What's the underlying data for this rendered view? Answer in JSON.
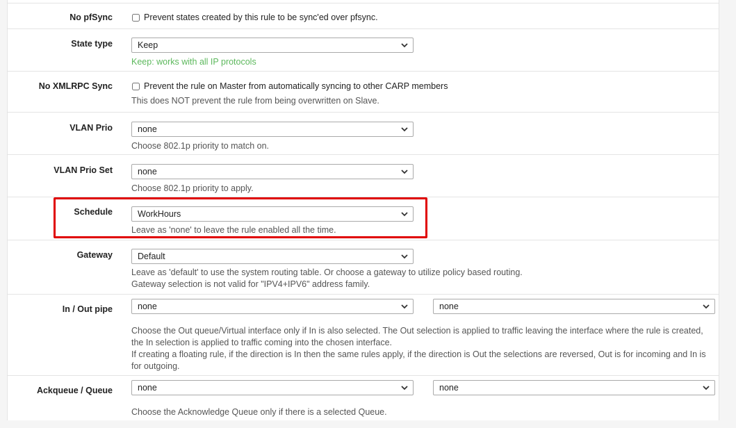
{
  "rows": {
    "pfsync": {
      "label": "No pfSync",
      "checkbox_label": "Prevent states created by this rule to be sync'ed over pfsync."
    },
    "state_type": {
      "label": "State type",
      "value": "Keep",
      "help": "Keep: works with all IP protocols"
    },
    "xmlrpc": {
      "label": "No XMLRPC Sync",
      "checkbox_label": "Prevent the rule on Master from automatically syncing to other CARP members",
      "help": "This does NOT prevent the rule from being overwritten on Slave."
    },
    "vlan_prio": {
      "label": "VLAN Prio",
      "value": "none",
      "help": "Choose 802.1p priority to match on."
    },
    "vlan_prio_set": {
      "label": "VLAN Prio Set",
      "value": "none",
      "help": "Choose 802.1p priority to apply."
    },
    "schedule": {
      "label": "Schedule",
      "value": "WorkHours",
      "help": "Leave as 'none' to leave the rule enabled all the time."
    },
    "gateway": {
      "label": "Gateway",
      "value": "Default",
      "help1": "Leave as 'default' to use the system routing table. Or choose a gateway to utilize policy based routing.",
      "help2": "Gateway selection is not valid for \"IPV4+IPV6\" address family."
    },
    "pipe": {
      "label": "In / Out pipe",
      "in_value": "none",
      "out_value": "none",
      "help1": "Choose the Out queue/Virtual interface only if In is also selected. The Out selection is applied to traffic leaving the interface where the rule is created,",
      "help2": "the In selection is applied to traffic coming into the chosen interface.",
      "help3": "If creating a floating rule, if the direction is In then the same rules apply, if the direction is Out the selections are reversed, Out is for incoming and In is",
      "help4": "for outgoing."
    },
    "queue": {
      "label": "Ackqueue / Queue",
      "ack_value": "none",
      "queue_value": "none",
      "help": "Choose the Acknowledge Queue only if there is a selected Queue."
    }
  },
  "colors": {
    "highlight": "#e00000",
    "help_green": "#5cb85c"
  }
}
